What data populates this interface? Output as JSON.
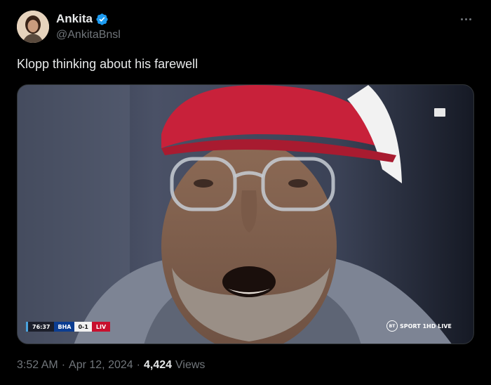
{
  "author": {
    "display_name": "Ankita",
    "handle": "@AnkitaBnsl",
    "verified_icon": "verified-badge-icon",
    "avatar_icon": "avatar"
  },
  "tweet": {
    "text": "Klopp thinking about his farewell"
  },
  "media": {
    "scorebug": {
      "clock": "76:37",
      "home": "BHA",
      "score": "0-1",
      "away": "LIV"
    },
    "broadcaster": {
      "logo": "BT",
      "label": "SPORT 1HD LIVE"
    }
  },
  "meta": {
    "time": "3:52 AM",
    "separator1": "·",
    "date": "Apr 12, 2024",
    "separator2": "·",
    "views_count": "4,424",
    "views_label": "Views"
  },
  "colors": {
    "background": "#000000",
    "text_primary": "#e7e9ea",
    "text_secondary": "#71767b",
    "verified_blue": "#1d9bf0"
  }
}
